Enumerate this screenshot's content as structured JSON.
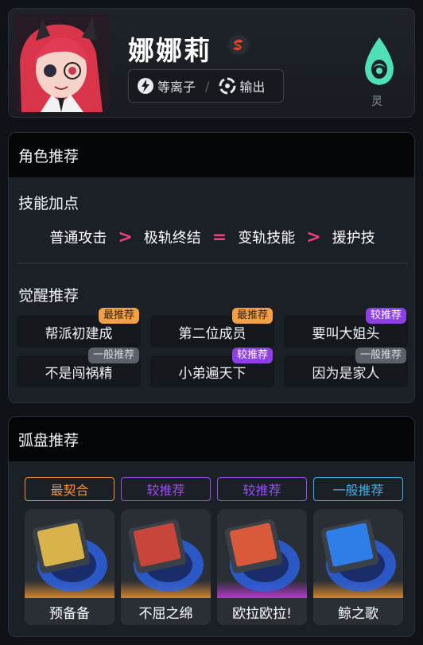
{
  "character": {
    "name": "娜娜莉",
    "rank_letter": "S",
    "tags": [
      {
        "icon": "lightning-icon",
        "label": "等离子"
      },
      {
        "icon": "attack-ring-icon",
        "label": "输出"
      }
    ],
    "element_label": "灵",
    "colors": {
      "element": "#4fe0b8",
      "rank": "#e8422a"
    }
  },
  "role_section": {
    "title": "角色推荐",
    "skill_title": "技能加点",
    "skills": [
      "普通攻击",
      "极轨终结",
      "变轨技能",
      "援护技"
    ],
    "operators": [
      ">",
      "=",
      ">"
    ],
    "wake_title": "觉醒推荐",
    "wakes": [
      {
        "label": "帮派初建成",
        "badge": "最推荐",
        "level": "best"
      },
      {
        "label": "第二位成员",
        "badge": "最推荐",
        "level": "best"
      },
      {
        "label": "要叫大姐头",
        "badge": "较推荐",
        "level": "good"
      },
      {
        "label": "不是闯祸精",
        "badge": "一般推荐",
        "level": "normal"
      },
      {
        "label": "小弟遍天下",
        "badge": "较推荐",
        "level": "good"
      },
      {
        "label": "因为是家人",
        "badge": "一般推荐",
        "level": "normal"
      }
    ]
  },
  "disc_section": {
    "title": "弧盘推荐",
    "discs": [
      {
        "rank": "最契合",
        "name": "预备备",
        "rank_color": "#f0913a",
        "glow": "#e08a2a"
      },
      {
        "rank": "较推荐",
        "name": "不屈之绵",
        "rank_color": "#9a4cf0",
        "glow": "#e08a2a"
      },
      {
        "rank": "较推荐",
        "name": "欧拉欧拉!",
        "rank_color": "#9a4cf0",
        "glow": "#c03ad8"
      },
      {
        "rank": "一般推荐",
        "name": "鲸之歌",
        "rank_color": "#3fb0e8",
        "glow": "#e08a2a"
      }
    ]
  }
}
